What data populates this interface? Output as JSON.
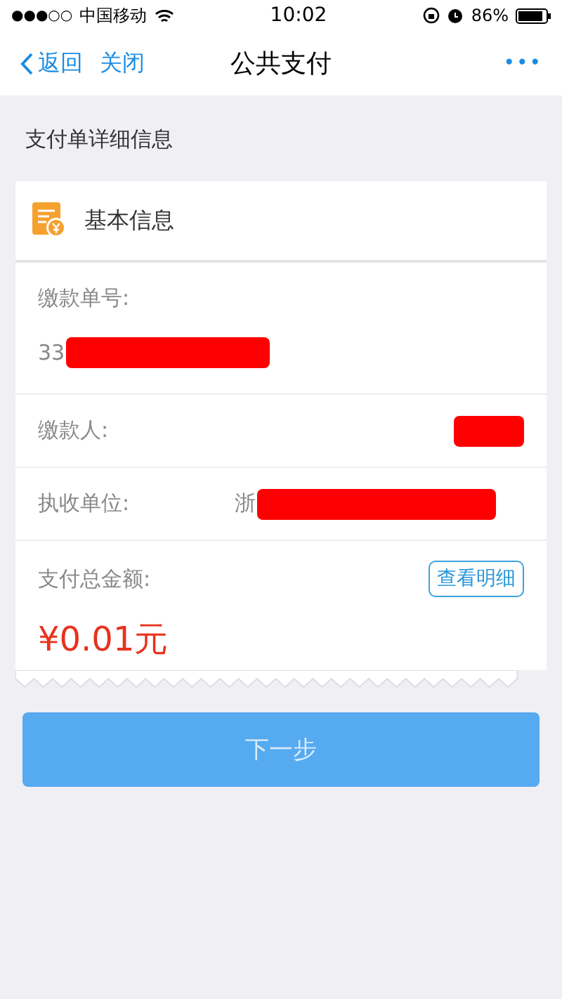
{
  "status_bar": {
    "signal": "●●●○○",
    "carrier": "中国移动",
    "time": "10:02",
    "battery": "86%"
  },
  "nav": {
    "back": "返回",
    "close": "关闭",
    "title": "公共支付",
    "more": "•••"
  },
  "section_title": "支付单详细信息",
  "card": {
    "title": "基本信息",
    "rows": [
      {
        "kind": "stacked",
        "label": "缴款单号:",
        "value": "33",
        "redacted": true
      },
      {
        "kind": "inline",
        "label": "缴款人:",
        "value": "",
        "redacted": true
      },
      {
        "kind": "inline",
        "label": "执收单位:",
        "value": "浙",
        "redacted": true
      }
    ],
    "total": {
      "label": "支付总金额:",
      "detail_button": "查看明细",
      "amount": "¥0.01元"
    }
  },
  "next_button": {
    "label": "下一步",
    "disabled": true
  }
}
